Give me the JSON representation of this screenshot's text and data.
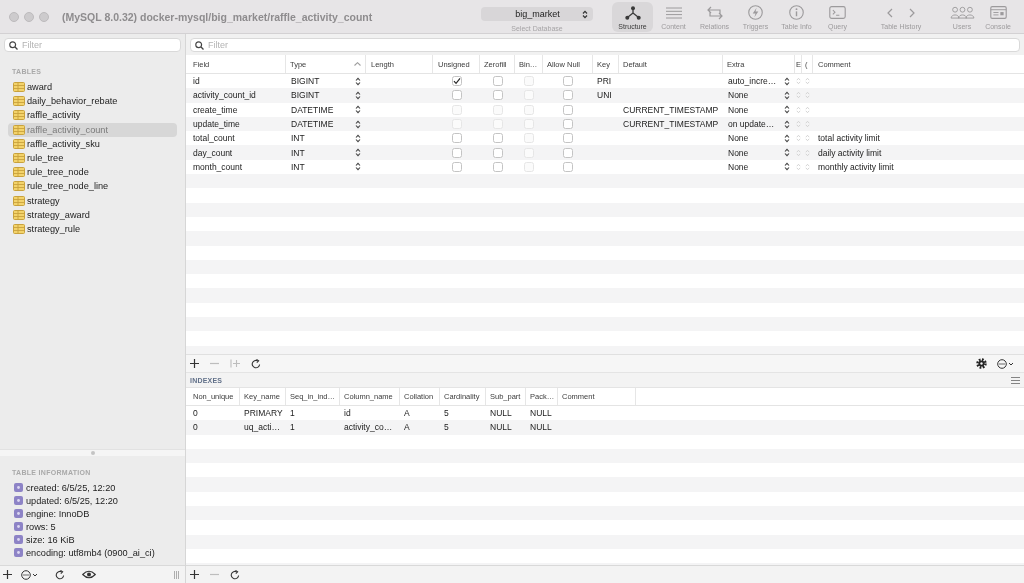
{
  "window": {
    "title": "(MySQL 8.0.32) docker-mysql/big_market/raffle_activity_count"
  },
  "database": {
    "value": "big_market",
    "label": "Select Database"
  },
  "toolbar": [
    {
      "label": "Structure",
      "selected": true
    },
    {
      "label": "Content",
      "selected": false
    },
    {
      "label": "Relations",
      "selected": false
    },
    {
      "label": "Triggers",
      "selected": false
    },
    {
      "label": "Table Info",
      "selected": false
    },
    {
      "label": "Query",
      "selected": false
    },
    {
      "label": "Table History",
      "selected": false
    },
    {
      "label": "Users",
      "selected": false
    },
    {
      "label": "Console",
      "selected": false
    }
  ],
  "sidebar": {
    "filter": {
      "placeholder": "Filter"
    },
    "tables_heading": "TABLES",
    "tables": [
      {
        "name": "award",
        "selected": false
      },
      {
        "name": "daily_behavior_rebate",
        "selected": false
      },
      {
        "name": "raffle_activity",
        "selected": false
      },
      {
        "name": "raffle_activity_count",
        "selected": true
      },
      {
        "name": "raffle_activity_sku",
        "selected": false
      },
      {
        "name": "rule_tree",
        "selected": false
      },
      {
        "name": "rule_tree_node",
        "selected": false
      },
      {
        "name": "rule_tree_node_line",
        "selected": false
      },
      {
        "name": "strategy",
        "selected": false
      },
      {
        "name": "strategy_award",
        "selected": false
      },
      {
        "name": "strategy_rule",
        "selected": false
      }
    ],
    "info_heading": "TABLE INFORMATION",
    "info": [
      "created: 6/5/25, 12:20",
      "updated: 6/5/25, 12:20",
      "engine: InnoDB",
      "rows: 5",
      "size: 16 KiB",
      "encoding: utf8mb4 (0900_ai_ci)"
    ]
  },
  "structure": {
    "filter": {
      "placeholder": "Filter"
    },
    "columns": [
      {
        "label": "Field",
        "sorted": false
      },
      {
        "label": "Type",
        "sorted": true
      },
      {
        "label": "Length",
        "sorted": false
      },
      {
        "label": "Unsigned",
        "sorted": false
      },
      {
        "label": "Zerofill",
        "sorted": false
      },
      {
        "label": "Bin…",
        "sorted": false
      },
      {
        "label": "Allow Null",
        "sorted": false
      },
      {
        "label": "Key",
        "sorted": false
      },
      {
        "label": "Default",
        "sorted": false
      },
      {
        "label": "Extra",
        "sorted": false
      },
      {
        "label": "E",
        "sorted": false
      },
      {
        "label": "(",
        "sorted": false
      },
      {
        "label": "Comment",
        "sorted": false
      }
    ],
    "rows": [
      {
        "field": "id",
        "type": "BIGINT",
        "unsigned": {
          "checked": true,
          "disabled": false
        },
        "zerofill": {
          "checked": false,
          "disabled": false
        },
        "binary": {
          "checked": false,
          "disabled": true
        },
        "allow_null": {
          "checked": false,
          "disabled": false
        },
        "key": "PRI",
        "extra": "auto_incre…"
      },
      {
        "field": "activity_count_id",
        "type": "BIGINT",
        "unsigned": {
          "checked": false,
          "disabled": false
        },
        "zerofill": {
          "checked": false,
          "disabled": false
        },
        "binary": {
          "checked": false,
          "disabled": true
        },
        "allow_null": {
          "checked": false,
          "disabled": false
        },
        "key": "UNI",
        "extra": "None"
      },
      {
        "field": "create_time",
        "type": "DATETIME",
        "unsigned": {
          "checked": false,
          "disabled": true
        },
        "zerofill": {
          "checked": false,
          "disabled": true
        },
        "binary": {
          "checked": false,
          "disabled": true
        },
        "allow_null": {
          "checked": false,
          "disabled": false
        },
        "default": "CURRENT_TIMESTAMP",
        "extra": "None"
      },
      {
        "field": "update_time",
        "type": "DATETIME",
        "unsigned": {
          "checked": false,
          "disabled": true
        },
        "zerofill": {
          "checked": false,
          "disabled": true
        },
        "binary": {
          "checked": false,
          "disabled": true
        },
        "allow_null": {
          "checked": false,
          "disabled": false
        },
        "default": "CURRENT_TIMESTAMP",
        "extra": "on update…"
      },
      {
        "field": "total_count",
        "type": "INT",
        "unsigned": {
          "checked": false,
          "disabled": false
        },
        "zerofill": {
          "checked": false,
          "disabled": false
        },
        "binary": {
          "checked": false,
          "disabled": true
        },
        "allow_null": {
          "checked": false,
          "disabled": false
        },
        "extra": "None",
        "comment": "total activity limit"
      },
      {
        "field": "day_count",
        "type": "INT",
        "unsigned": {
          "checked": false,
          "disabled": false
        },
        "zerofill": {
          "checked": false,
          "disabled": false
        },
        "binary": {
          "checked": false,
          "disabled": true
        },
        "allow_null": {
          "checked": false,
          "disabled": false
        },
        "extra": "None",
        "comment": "daily activity limit"
      },
      {
        "field": "month_count",
        "type": "INT",
        "unsigned": {
          "checked": false,
          "disabled": false
        },
        "zerofill": {
          "checked": false,
          "disabled": false
        },
        "binary": {
          "checked": false,
          "disabled": true
        },
        "allow_null": {
          "checked": false,
          "disabled": false
        },
        "extra": "None",
        "comment": "monthly activity limit"
      }
    ]
  },
  "indexes": {
    "heading": "INDEXES",
    "columns": [
      "Non_unique",
      "Key_name",
      "Seq_in_ind…",
      "Column_name",
      "Collation",
      "Cardinality",
      "Sub_part",
      "Pack…",
      "Comment"
    ],
    "rows": [
      [
        "0",
        "PRIMARY",
        "1",
        "id",
        "A",
        "5",
        "NULL",
        "NULL"
      ],
      [
        "0",
        "uq_acti…",
        "1",
        "activity_co…",
        "A",
        "5",
        "NULL",
        "NULL"
      ]
    ]
  }
}
